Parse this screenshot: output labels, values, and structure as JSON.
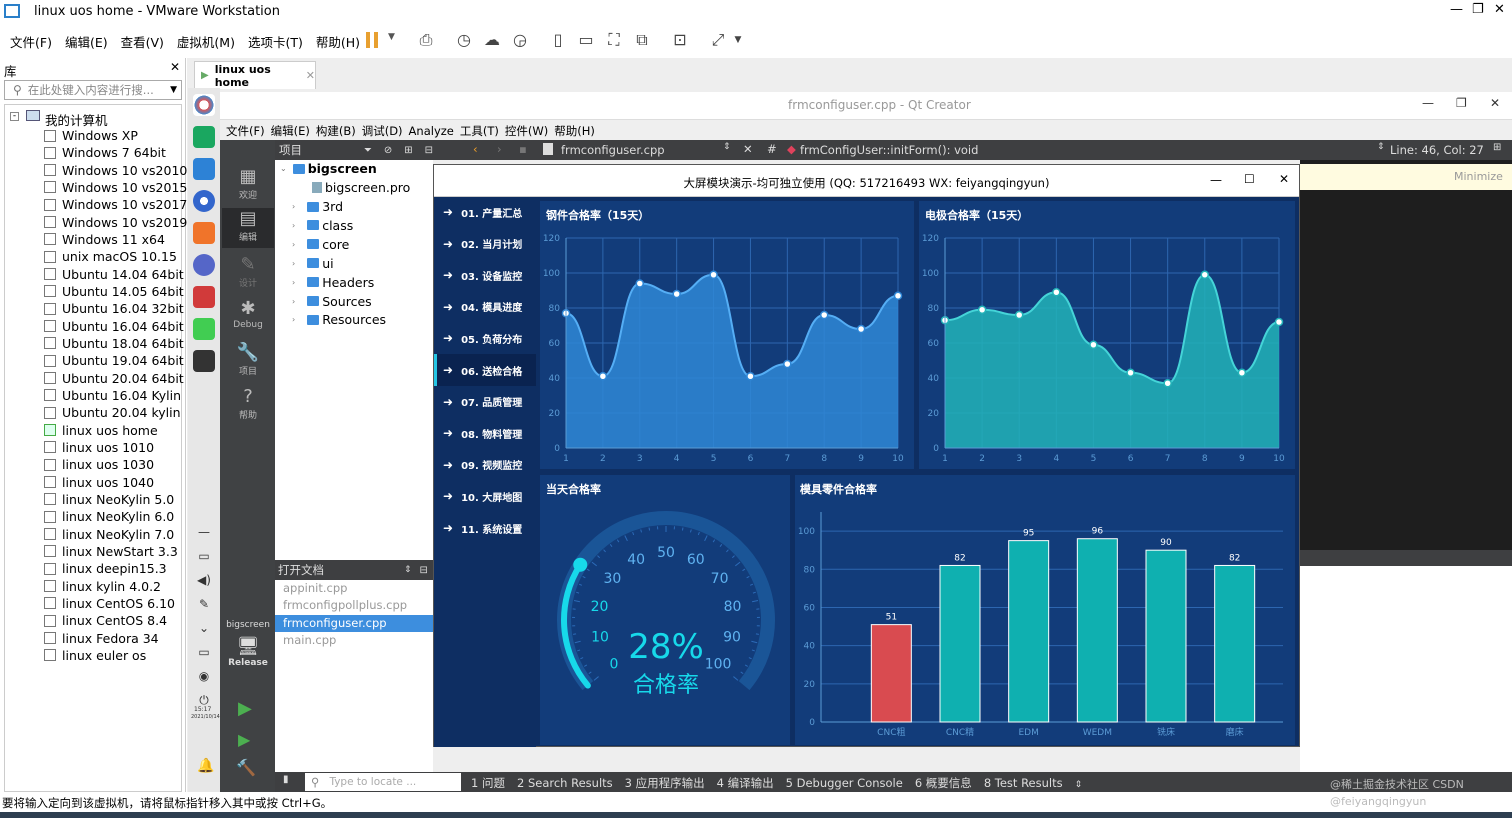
{
  "vm": {
    "title": "linux uos home - VMware Workstation",
    "menu": [
      "文件(F)",
      "编辑(E)",
      "查看(V)",
      "虚拟机(M)",
      "选项卡(T)",
      "帮助(H)"
    ],
    "library_label": "库",
    "search_placeholder": "在此处键入内容进行搜...",
    "tree_root": "我的计算机",
    "machines": [
      "Windows XP",
      "Windows 7 64bit",
      "Windows 10 vs2010",
      "Windows 10 vs2015",
      "Windows 10 vs2017",
      "Windows 10 vs2019",
      "Windows 11 x64",
      "unix macOS 10.15",
      "Ubuntu 14.04 64bit",
      "Ubuntu 14.05 64bit",
      "Ubuntu 16.04 32bit",
      "Ubuntu 16.04 64bit",
      "Ubuntu 18.04 64bit",
      "Ubuntu 19.04 64bit",
      "Ubuntu 20.04 64bit",
      "Ubuntu 16.04 Kylin",
      "Ubuntu 20.04 kylin",
      "linux uos home",
      "linux uos 1010",
      "linux uos 1030",
      "linux uos 1040",
      "linux NeoKylin 5.0",
      "linux NeoKylin 6.0",
      "linux NeoKylin 7.0",
      "linux NewStart 3.3",
      "linux deepin15.3",
      "linux kylin 4.0.2",
      "linux CentOS 6.10",
      "linux CentOS 8.4",
      "linux Fedora 34",
      "linux euler os"
    ],
    "tab": "linux uos home",
    "status": "要将输入定向到该虚拟机，请将鼠标指针移入其中或按 Ctrl+G。"
  },
  "qt": {
    "title": "frmconfiguser.cpp - Qt Creator",
    "menu": [
      "文件(F)",
      "编辑(E)",
      "构建(B)",
      "调试(D)",
      "Analyze",
      "工具(T)",
      "控件(W)",
      "帮助(H)"
    ],
    "project_label": "项目",
    "project_root": "bigscreen",
    "pro_file": "bigscreen.pro",
    "folders": [
      "3rd",
      "class",
      "core",
      "ui",
      "Headers",
      "Sources",
      "Resources"
    ],
    "open_docs_label": "打开文档",
    "open_docs": [
      "appinit.cpp",
      "frmconfigpollplus.cpp",
      "frmconfiguser.cpp",
      "main.cpp"
    ],
    "file_tab": "frmconfiguser.cpp",
    "function": "frmConfigUser::initForm(): void",
    "line_col": "Line: 46, Col: 27",
    "minimize": "Minimize",
    "modes": [
      "欢迎",
      "编辑",
      "设计",
      "Debug",
      "项目",
      "帮助"
    ],
    "kit": "bigscreen",
    "build": "Release",
    "clock_time": "15:17",
    "clock_date": "2021/10/14",
    "locate_placeholder": "Type to locate ...",
    "bottom_tabs": [
      "1 问题",
      "2 Search Results",
      "3 应用程序输出",
      "4 编译输出",
      "5 Debugger Console",
      "6 概要信息",
      "8 Test Results"
    ]
  },
  "app": {
    "title": "大屏模块演示-均可独立使用 (QQ: 517216493 WX: feiyangqingyun)",
    "nav": [
      "01. 产量汇总",
      "02. 当月计划",
      "03. 设备监控",
      "04. 模具进度",
      "05. 负荷分布",
      "06. 送检合格",
      "07. 品质管理",
      "08. 物料管理",
      "09. 视频监控",
      "10. 大屏地图",
      "11. 系统设置"
    ],
    "gauge_title": "当天合格率",
    "gauge_value": "28%",
    "gauge_label": "合格率"
  },
  "chart_data": [
    {
      "type": "area",
      "title": "钢件合格率（15天）",
      "x": [
        1,
        2,
        3,
        4,
        5,
        6,
        7,
        8,
        9,
        10
      ],
      "values": [
        77,
        41,
        94,
        88,
        99,
        41,
        48,
        76,
        68,
        87
      ],
      "ylim": [
        0,
        120
      ],
      "color": "#2f87d6"
    },
    {
      "type": "area",
      "title": "电极合格率（15天）",
      "x": [
        1,
        2,
        3,
        4,
        5,
        6,
        7,
        8,
        9,
        10
      ],
      "values": [
        73,
        79,
        76,
        89,
        59,
        43,
        37,
        99,
        43,
        72
      ],
      "ylim": [
        0,
        120
      ],
      "color": "#22b3b8"
    },
    {
      "type": "gauge",
      "title": "当天合格率",
      "value": 28,
      "range": [
        0,
        100
      ],
      "ticks": [
        0,
        10,
        20,
        30,
        40,
        50,
        60,
        70,
        80,
        90,
        100
      ]
    },
    {
      "type": "bar",
      "title": "模具零件合格率",
      "categories": [
        "CNC粗",
        "CNC精",
        "EDM",
        "WEDM",
        "铣床",
        "磨床"
      ],
      "values": [
        51,
        82,
        95,
        96,
        90,
        82
      ],
      "ylim": [
        0,
        110
      ],
      "colors": [
        "#d94b50",
        "#0fb0b0",
        "#0fb0b0",
        "#0fb0b0",
        "#0fb0b0",
        "#0fb0b0"
      ]
    }
  ],
  "watermark": "@稀土掘金技术社区 CSDN @feiyangqingyun"
}
